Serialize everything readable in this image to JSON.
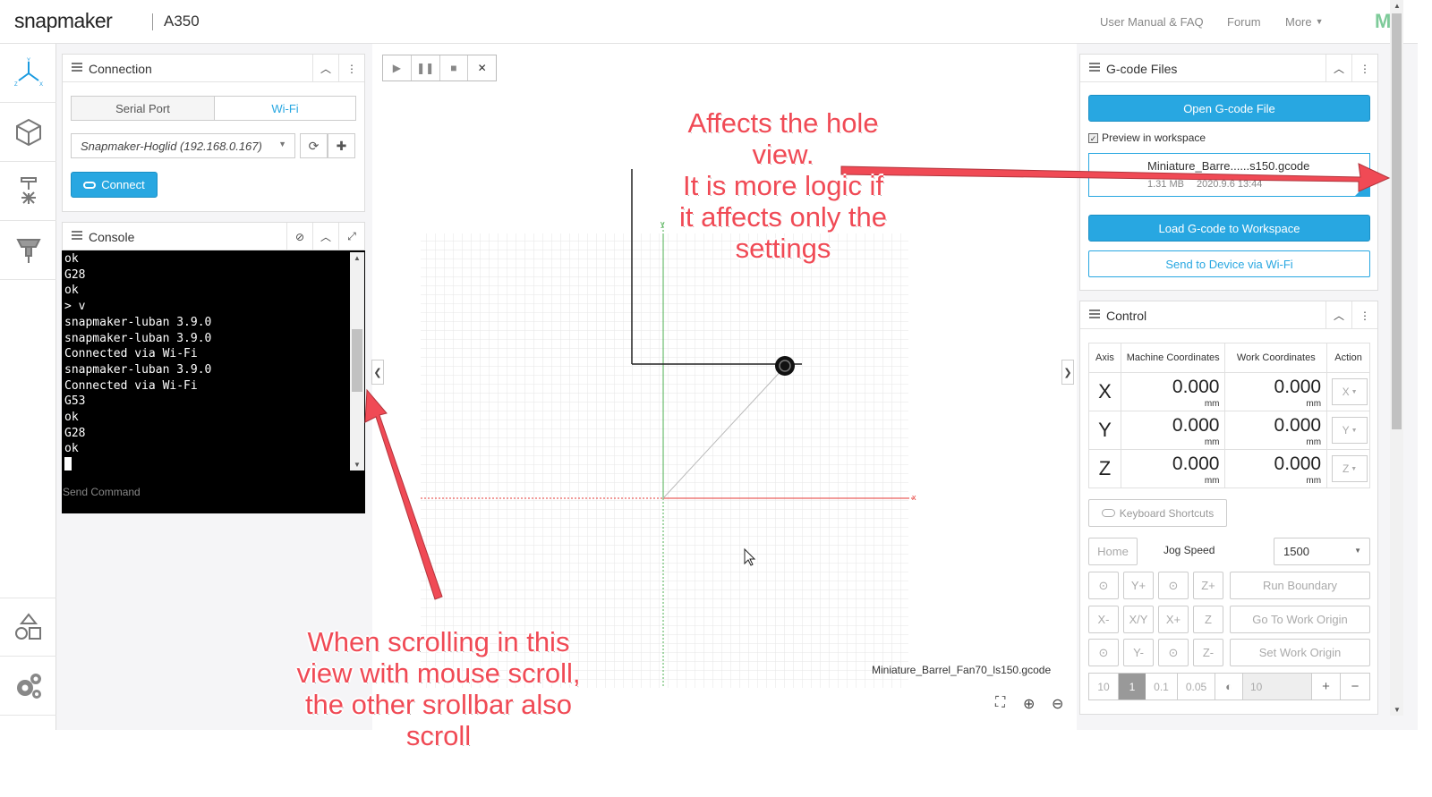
{
  "header": {
    "logo": "snapmaker",
    "model": "A350",
    "links": [
      "User Manual & FAQ",
      "Forum",
      "More"
    ],
    "brand_mark": "M"
  },
  "rail": {
    "items": [
      "workspace-axis-icon",
      "3d-cube-icon",
      "laser-icon",
      "cnc-icon"
    ],
    "bottom": [
      "shapes-icon",
      "settings-gears-icon"
    ]
  },
  "connection": {
    "title": "Connection",
    "tabs": [
      "Serial Port",
      "Wi-Fi"
    ],
    "active_tab": "Wi-Fi",
    "selected_device": "Snapmaker-Hoglid (192.168.0.167)",
    "connect_label": "Connect"
  },
  "console": {
    "title": "Console",
    "lines": [
      "ok",
      "G28",
      "ok",
      "> v",
      "snapmaker-luban 3.9.0",
      "snapmaker-luban 3.9.0",
      "Connected via Wi-Fi",
      "snapmaker-luban 3.9.0",
      "Connected via Wi-Fi",
      "G53",
      "ok",
      "G28",
      "ok"
    ],
    "placeholder": "Send Command"
  },
  "workspace": {
    "gcode_filename": "Miniature_Barrel_Fan70_ls150.gcode",
    "axis_y": "y",
    "axis_x": "x"
  },
  "gcode_files": {
    "title": "G-code Files",
    "open_label": "Open G-code File",
    "preview_label": "Preview in workspace",
    "preview_checked": true,
    "file_name": "Miniature_Barre......s150.gcode",
    "file_size": "1.31 MB",
    "file_date": "2020.9.6 13:44",
    "load_label": "Load G-code to Workspace",
    "send_label": "Send to Device via Wi-Fi"
  },
  "control": {
    "title": "Control",
    "headers": [
      "Axis",
      "Machine Coordinates",
      "Work Coordinates",
      "Action"
    ],
    "rows": [
      {
        "axis": "X",
        "machine": "0.000",
        "work": "0.000",
        "unit": "mm",
        "action": "X"
      },
      {
        "axis": "Y",
        "machine": "0.000",
        "work": "0.000",
        "unit": "mm",
        "action": "Y"
      },
      {
        "axis": "Z",
        "machine": "0.000",
        "work": "0.000",
        "unit": "mm",
        "action": "Z"
      }
    ],
    "keyboard_label": "Keyboard Shortcuts",
    "home_label": "Home",
    "jog_speed_label": "Jog Speed",
    "jog_speed_value": "1500",
    "jog_row1": [
      "Y+",
      "Z+"
    ],
    "jog_row2": [
      "X-",
      "X/Y",
      "X+",
      "Z"
    ],
    "jog_row3": [
      "Y-",
      "Z-"
    ],
    "run_boundary": "Run Boundary",
    "go_origin": "Go To Work Origin",
    "set_origin": "Set Work Origin",
    "steps": [
      "10",
      "1",
      "0.1",
      "0.05"
    ],
    "active_step": "1",
    "custom_step": "10"
  },
  "annotations": {
    "top": [
      "Affects the hole",
      "view.",
      "It is more logic if",
      "it affects only the",
      "settings"
    ],
    "bottom": [
      "When scrolling in this",
      "view with mouse scroll,",
      "the other srollbar also",
      "scroll"
    ],
    "color": "#f04a55"
  }
}
